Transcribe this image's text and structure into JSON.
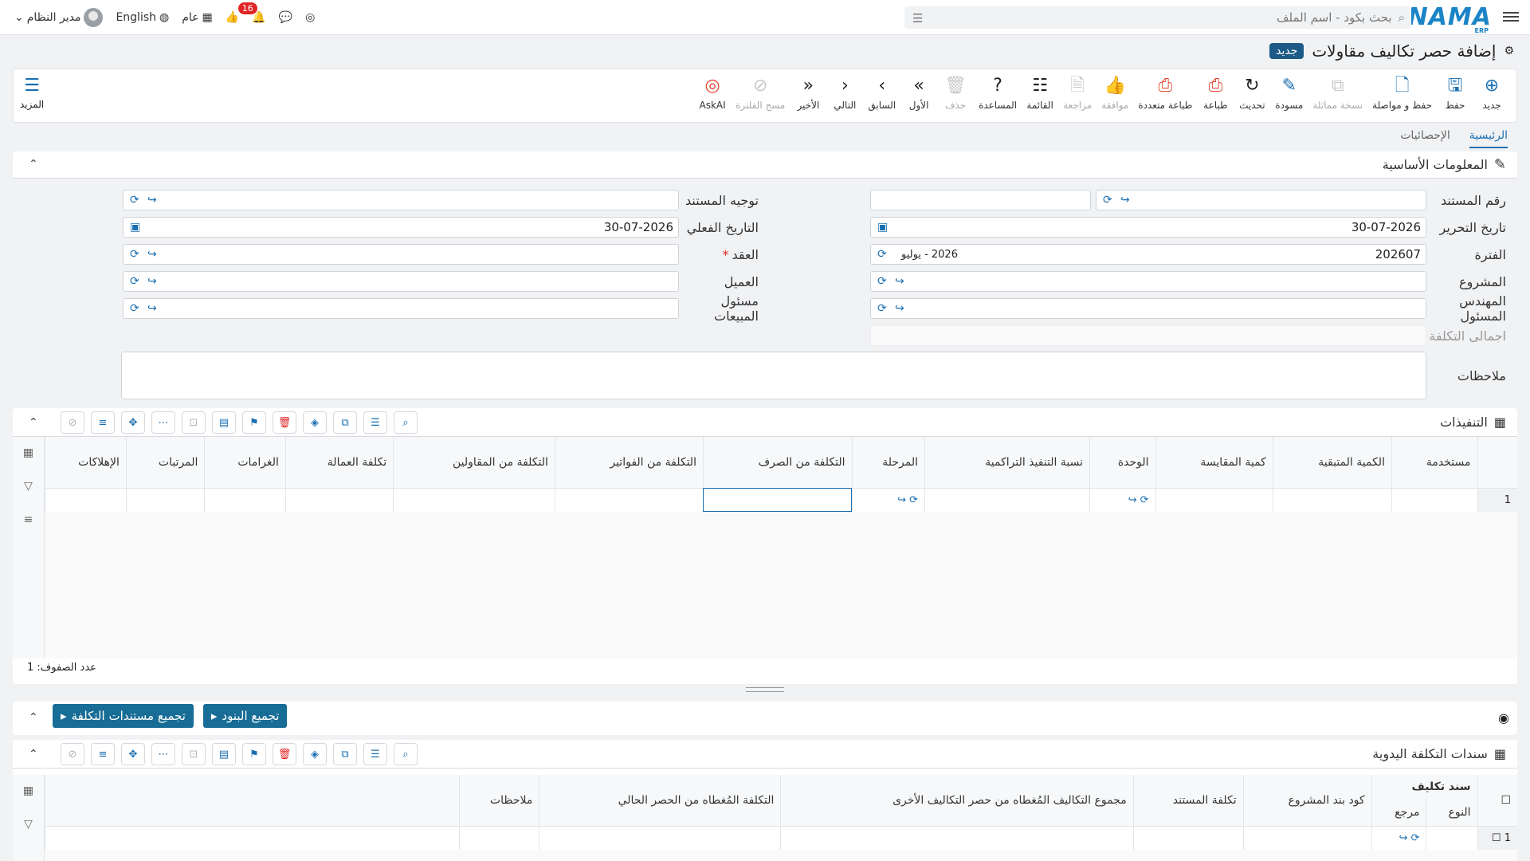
{
  "topbar": {
    "search_placeholder": "بحث بكود - اسم الملف",
    "logo": "NAMA",
    "logo_sub": "ERP",
    "user": "مدير النظام",
    "language": "English",
    "scope": "عام",
    "notif_count": "16"
  },
  "page": {
    "title": "إضافة حصر تكاليف مقاولات",
    "badge": "جديد"
  },
  "toolbar": {
    "items": [
      "جديد",
      "حفظ",
      "حفظ و مواصلة",
      "نسخة مماثلة",
      "مسودة",
      "تحديث",
      "طباعة",
      "طباعة متعددة",
      "موافقة",
      "مراجعة",
      "القائمة",
      "المساعدة",
      "حذف",
      "الأول",
      "السابق",
      "التالي",
      "الأخير",
      "مسح الفلترة",
      "AskAI"
    ],
    "more": "المزيد"
  },
  "tabs": [
    "الرئيسية",
    "الإحصائيات"
  ],
  "basic": {
    "title": "المعلومات الأساسية",
    "doc_no_label": "رقم المستند",
    "doc_dir_label": "توجيه المستند",
    "edit_date_label": "تاريخ التحرير",
    "edit_date": "30-07-2026",
    "actual_date_label": "التاريخ الفعلي",
    "actual_date": "30-07-2026",
    "period_label": "الفترة",
    "period": "202607",
    "period_name": "2026 - يوليو",
    "contract_label": "العقد",
    "project_label": "المشروع",
    "client_label": "العميل",
    "engineer_label": "المهندس المسئول",
    "sales_label": "مسئول المبيعات",
    "total_cost_label": "اجمالى التكلفة",
    "notes_label": "ملاحظات"
  },
  "exec": {
    "title": "التنفيذات",
    "columns": [
      "مستخدمة",
      "الكمية المتبقية",
      "كمية المقايسة",
      "الوحدة",
      "نسبة التنفيذ التراكمية",
      "المرحلة",
      "التكلفة من الصرف",
      "التكلفة من الفواتير",
      "التكلفة من المقاولين",
      "تكلفة العمالة",
      "الغرامات",
      "المرتبات",
      "الإهلاكات"
    ],
    "row_no": "1",
    "row_count_label": "عدد الصفوف: 1"
  },
  "actions": {
    "collect_items": "تجميع البنود",
    "collect_cost_docs": "تجميع مستندات التكلفة"
  },
  "manual": {
    "title": "سندات التكلفة اليدوية",
    "group_header": "سند تكليف",
    "columns": [
      "النوع",
      "مرجع",
      "كود بند المشروع",
      "تكلفة المستند",
      "مجموع التكاليف المُغطاه من حصر التكاليف الأخرى",
      "التكلفة المُغطاه من الحصر الحالي",
      "ملاحظات"
    ],
    "row_no": "1"
  }
}
